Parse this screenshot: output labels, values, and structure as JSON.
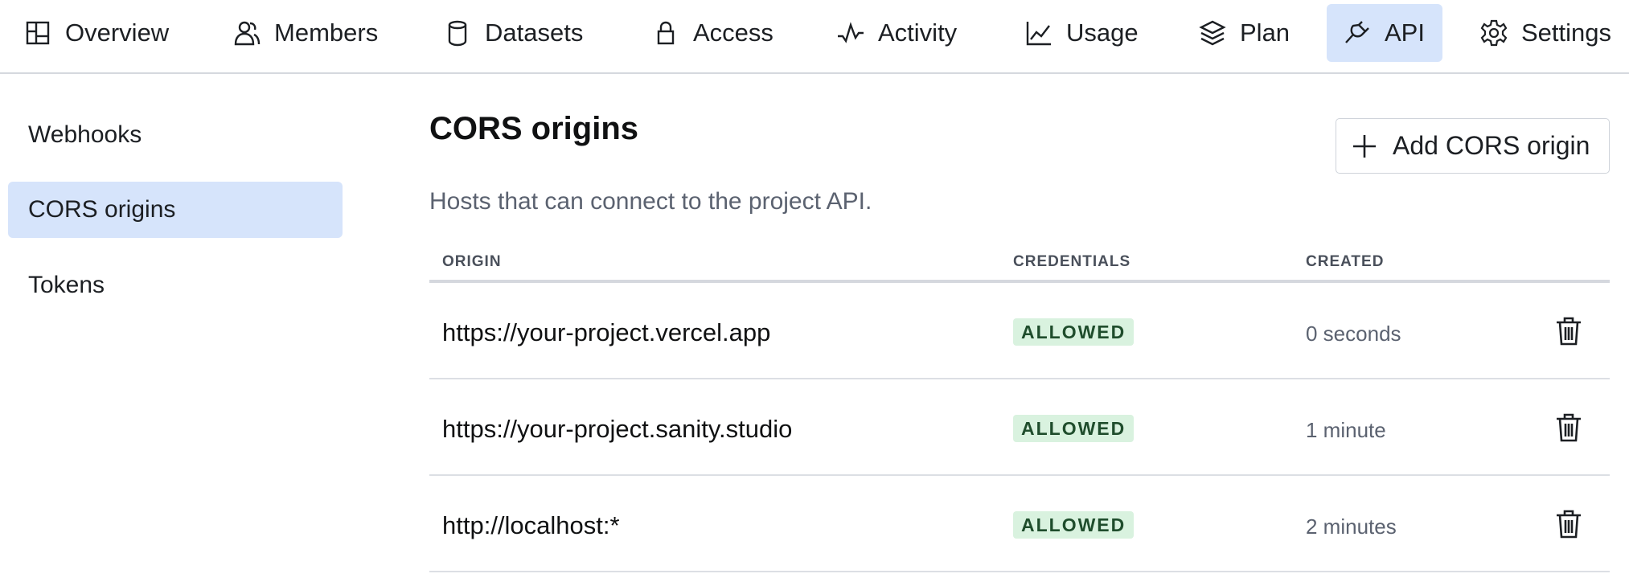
{
  "nav": {
    "tabs": [
      {
        "label": "Overview",
        "icon": "overview-icon"
      },
      {
        "label": "Members",
        "icon": "members-icon"
      },
      {
        "label": "Datasets",
        "icon": "database-icon"
      },
      {
        "label": "Access",
        "icon": "lock-icon"
      },
      {
        "label": "Activity",
        "icon": "activity-icon"
      },
      {
        "label": "Usage",
        "icon": "chart-line-icon"
      },
      {
        "label": "Plan",
        "icon": "layers-icon"
      },
      {
        "label": "API",
        "icon": "plug-icon",
        "active": true
      },
      {
        "label": "Settings",
        "icon": "gear-icon"
      }
    ]
  },
  "sidebar": {
    "items": [
      {
        "label": "Webhooks"
      },
      {
        "label": "CORS origins",
        "active": true
      },
      {
        "label": "Tokens"
      }
    ]
  },
  "main": {
    "title": "CORS origins",
    "subtitle": "Hosts that can connect to the project API.",
    "add_button_label": "Add CORS origin",
    "columns": [
      "ORIGIN",
      "CREDENTIALS",
      "CREATED"
    ],
    "rows": [
      {
        "origin": "https://your-project.vercel.app",
        "credentials": "ALLOWED",
        "created": "0 seconds"
      },
      {
        "origin": "https://your-project.sanity.studio",
        "credentials": "ALLOWED",
        "created": "1 minute"
      },
      {
        "origin": "http://localhost:*",
        "credentials": "ALLOWED",
        "created": "2 minutes"
      }
    ]
  },
  "colors": {
    "active_bg": "#d6e4fb",
    "badge_bg": "#d9f2df",
    "badge_text": "#1f4d2c",
    "muted_text": "#5b6270"
  }
}
